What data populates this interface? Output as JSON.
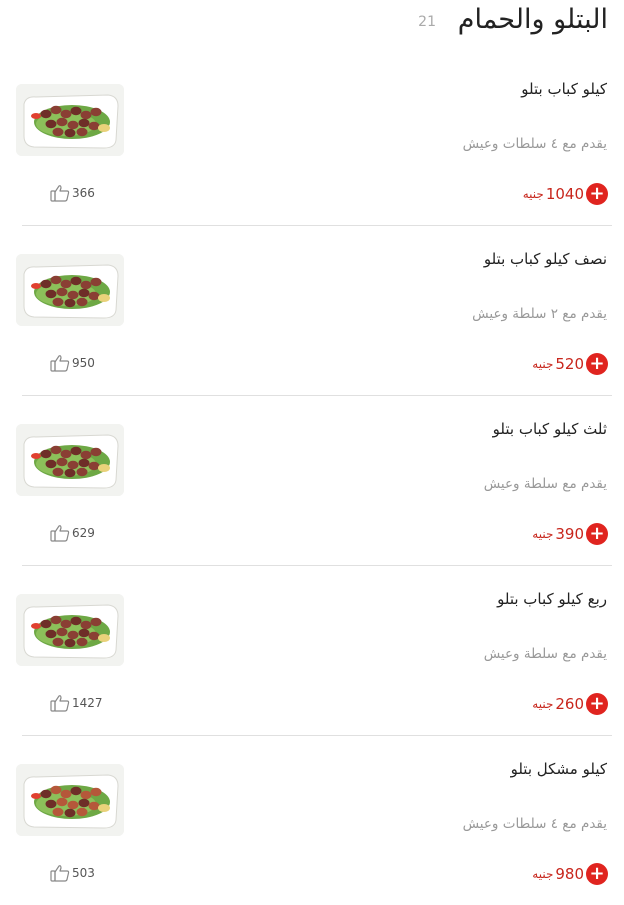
{
  "section": {
    "title": "البتلو والحمام",
    "count": "21"
  },
  "items": [
    {
      "name": "كيلو كباب بتلو",
      "description": "يقدم مع ٤ سلطات وعيش",
      "price": "1040",
      "currency": "جنيه",
      "likes": "366",
      "image": "kebab-plate"
    },
    {
      "name": "نصف كيلو كباب بتلو",
      "description": "يقدم مع ٢ سلطة وعيش",
      "price": "520",
      "currency": "جنيه",
      "likes": "950",
      "image": "kebab-plate"
    },
    {
      "name": "ثلث كيلو كباب بتلو",
      "description": "يقدم مع سلطة وعيش",
      "price": "390",
      "currency": "جنيه",
      "likes": "629",
      "image": "kebab-plate"
    },
    {
      "name": "ربع كيلو كباب بتلو",
      "description": "يقدم مع سلطة وعيش",
      "price": "260",
      "currency": "جنيه",
      "likes": "1427",
      "image": "kebab-plate"
    },
    {
      "name": "كيلو مشكل بتلو",
      "description": "يقدم مع ٤ سلطات وعيش",
      "price": "980",
      "currency": "جنيه",
      "likes": "503",
      "image": "mixed-grill-plate"
    }
  ],
  "icons": {
    "add": "plus-circle-icon",
    "like": "thumbs-up-icon"
  },
  "colors": {
    "accent": "#e0241f",
    "price": "#c8261c",
    "muted": "#999999"
  }
}
